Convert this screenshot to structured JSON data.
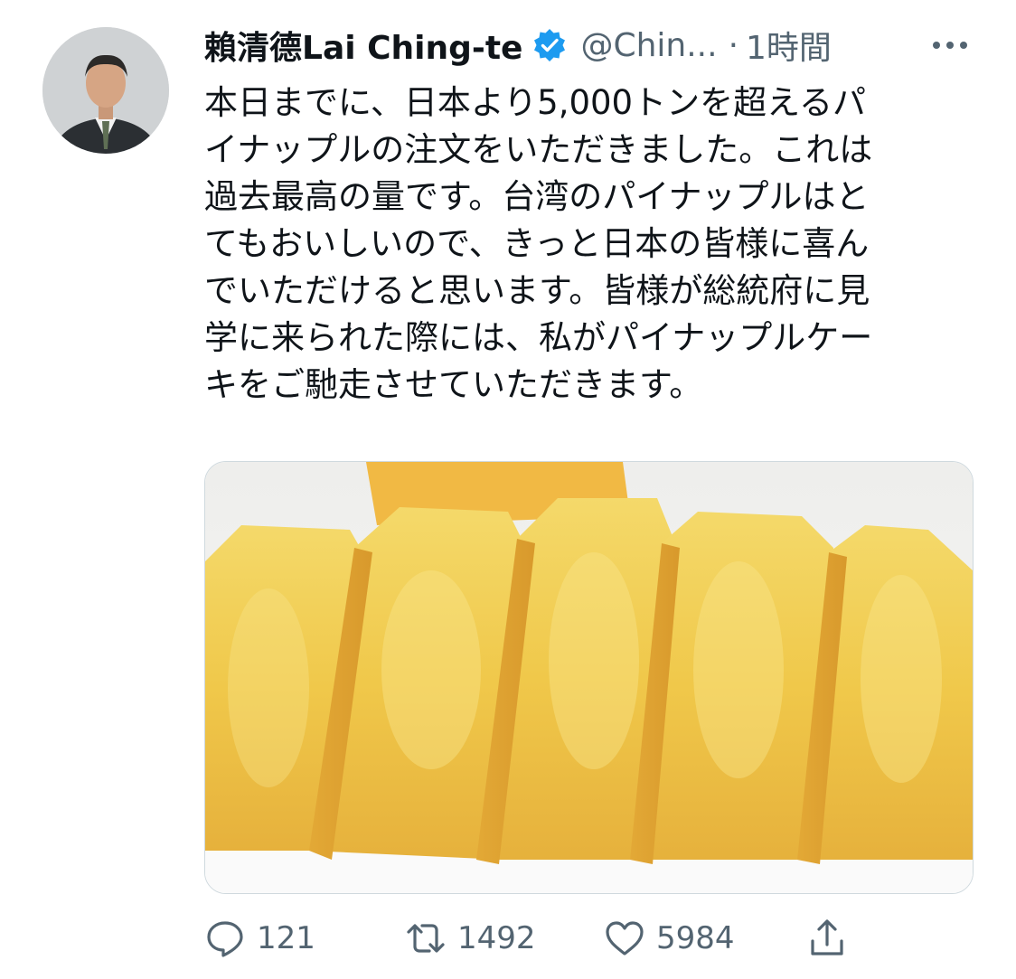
{
  "tweet": {
    "author": {
      "display_name": "賴清德Lai Ching-te",
      "handle": "@Chin...",
      "verified": true,
      "avatar": "user-avatar-portrait"
    },
    "separator": "·",
    "time": "1時間",
    "more_icon": "more-dots-icon",
    "text_lines": [
      "本日までに、日本より5,000トンを超えるパ",
      "イナップルの注文をいただきました。これは",
      "過去最高の量です。台湾のパイナップルはと",
      "てもおいしいので、きっと日本の皆様に喜ん",
      "でいただけると思います。皆様が総統府に見",
      "学に来られた際には、私がパイナップルケー",
      "キをご馳走させていただきます。"
    ],
    "media": "pineapple-cakes-photo",
    "actions": {
      "reply": {
        "icon": "reply-icon",
        "count": "121"
      },
      "retweet": {
        "icon": "retweet-icon",
        "count": "1492"
      },
      "like": {
        "icon": "heart-icon",
        "count": "5984"
      },
      "share": {
        "icon": "share-icon"
      }
    }
  },
  "colors": {
    "text": "#0f1419",
    "secondary": "#536471",
    "verified": "#1d9bf0",
    "border": "#cfd9de"
  }
}
